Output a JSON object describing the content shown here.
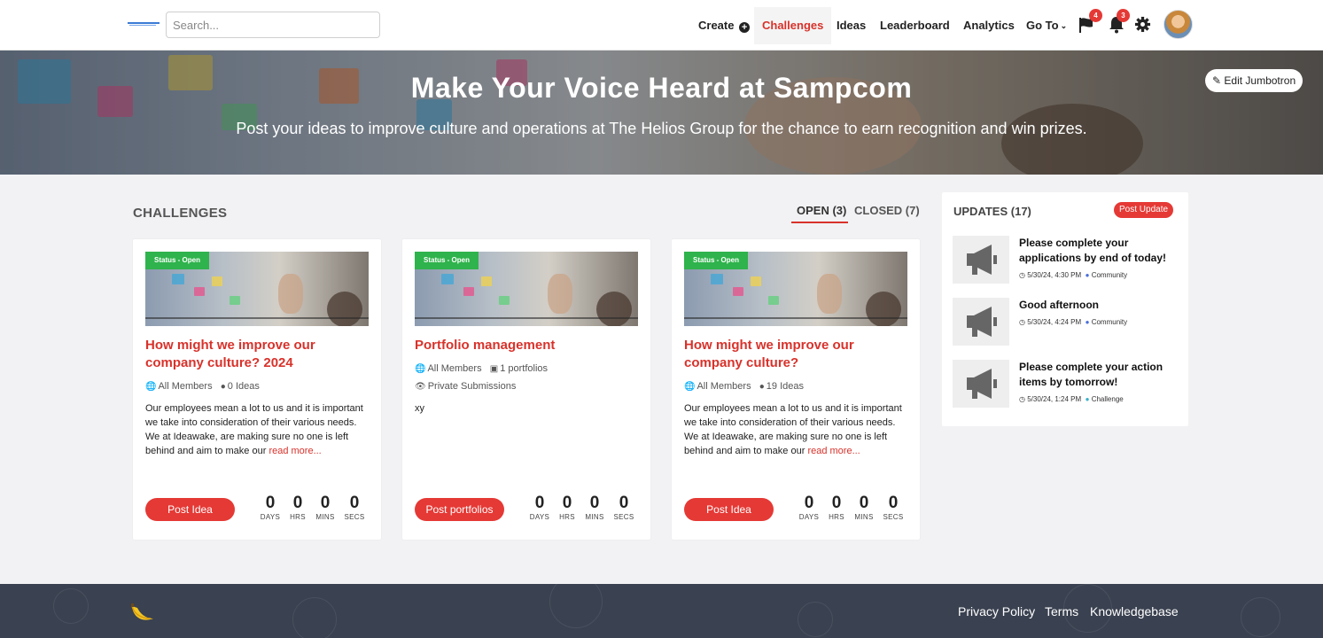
{
  "nav": {
    "search_placeholder": "Search...",
    "create": "Create",
    "challenges": "Challenges",
    "ideas": "Ideas",
    "leaderboard": "Leaderboard",
    "analytics": "Analytics",
    "goto": "Go To",
    "flag_badge": "4",
    "bell_badge": "3"
  },
  "hero": {
    "title": "Make Your Voice Heard at Sampcom",
    "subtitle": "Post your ideas to improve culture and operations at The Helios Group for the chance to earn recognition and win prizes.",
    "edit_label": "Edit Jumbotron"
  },
  "challenges": {
    "section_title": "CHALLENGES",
    "tab_open": "OPEN (3)",
    "tab_closed": "CLOSED (7)",
    "cards": [
      {
        "status": "Status - Open",
        "title": "How might we improve our company culture? 2024",
        "audience": "All Members",
        "count": "0 Ideas",
        "private": "",
        "description": "Our employees mean a lot to us and it is important we take into consideration of their various needs. We at Ideawake, are making sure no one is left behind and aim to make our",
        "read_more": "read more...",
        "button": "Post Idea",
        "countdown": {
          "days": "0",
          "hrs": "0",
          "mins": "0",
          "secs": "0"
        }
      },
      {
        "status": "Status - Open",
        "title": "Portfolio management",
        "audience": "All Members",
        "count": "1 portfolios",
        "private": "Private Submissions",
        "description": "xy",
        "read_more": "",
        "button": "Post portfolios",
        "countdown": {
          "days": "0",
          "hrs": "0",
          "mins": "0",
          "secs": "0"
        }
      },
      {
        "status": "Status - Open",
        "title": "How might we improve our company culture?",
        "audience": "All Members",
        "count": "19 Ideas",
        "private": "",
        "description": "Our employees mean a lot to us and it is important we take into consideration of their various needs. We at Ideawake, are making sure no one is left behind and aim to make our",
        "read_more": "read more...",
        "button": "Post Idea",
        "countdown": {
          "days": "0",
          "hrs": "0",
          "mins": "0",
          "secs": "0"
        }
      }
    ],
    "countdown_labels": {
      "days": "DAYS",
      "hrs": "HRS",
      "mins": "MINS",
      "secs": "SECS"
    }
  },
  "updates": {
    "title": "UPDATES (17)",
    "post_button": "Post Update",
    "items": [
      {
        "headline": "Please complete your applications by end of today!",
        "time": "5/30/24, 4:30 PM",
        "tag": "Community"
      },
      {
        "headline": "Good afternoon",
        "time": "5/30/24, 4:24 PM",
        "tag": "Community"
      },
      {
        "headline": "Please complete your action items by tomorrow!",
        "time": "5/30/24, 1:24 PM",
        "tag": "Challenge"
      }
    ]
  },
  "footer": {
    "privacy": "Privacy Policy",
    "terms": "Terms",
    "knowledgebase": "Knowledgebase"
  },
  "colors": {
    "accent": "#d8322b",
    "status_green": "#2fb34c",
    "footer": "#3a4150"
  },
  "icons": [
    "plus-circle-icon",
    "chevron-down-icon",
    "flag-icon",
    "bell-icon",
    "gear-icon",
    "edit-icon",
    "globe-icon",
    "bulb-icon",
    "portfolio-icon",
    "eye-slash-icon",
    "megaphone-icon",
    "clock-icon",
    "users-icon",
    "challenge-icon",
    "banana-logo-icon"
  ]
}
